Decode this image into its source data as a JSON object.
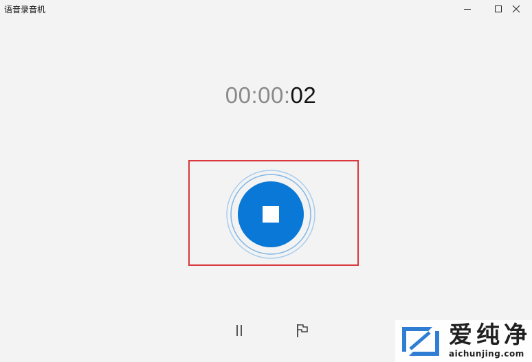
{
  "window": {
    "title": "语音录音机",
    "minimize_icon": "minimize-icon",
    "maximize_icon": "maximize-icon",
    "close_icon": "close-icon"
  },
  "recorder": {
    "elapsed_dim": "00:00:",
    "elapsed_seconds": "02",
    "stop_icon": "stop-icon",
    "pause_icon": "pause-icon",
    "marker_icon": "flag-icon"
  },
  "colors": {
    "accent": "#0a78d6",
    "highlight_frame": "#d8383e",
    "background": "#f3f3f3"
  },
  "watermark": {
    "brand": "爱纯净",
    "url": "aichunjing.com"
  }
}
